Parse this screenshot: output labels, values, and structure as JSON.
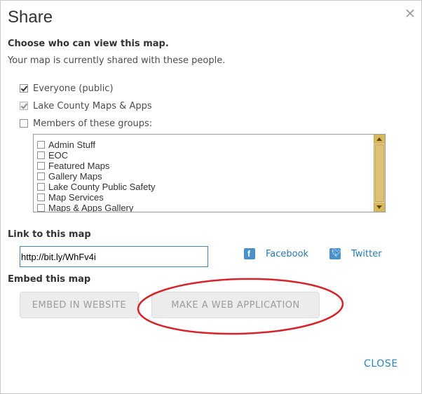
{
  "dialog": {
    "title": "Share",
    "close_icon": "close-icon"
  },
  "visibility": {
    "heading": "Choose who can view this map.",
    "description": "Your map is currently shared with these people.",
    "options": [
      {
        "label": "Everyone (public)",
        "checked": true,
        "disabled": false
      },
      {
        "label": "Lake County Maps & Apps",
        "checked": true,
        "disabled": true
      },
      {
        "label": "Members of these groups:",
        "checked": false,
        "disabled": false
      }
    ],
    "groups": [
      "Admin Stuff",
      "EOC",
      "Featured Maps",
      "Gallery Maps",
      "Lake County Public Safety",
      "Map Services",
      "Maps & Apps Gallery"
    ]
  },
  "link": {
    "heading": "Link to this map",
    "url": "http://bit.ly/WhFv4i",
    "facebook_label": "Facebook",
    "twitter_label": "Twitter"
  },
  "embed": {
    "heading": "Embed this map",
    "embed_button": "EMBED IN WEBSITE",
    "web_app_button": "MAKE A WEB APPLICATION"
  },
  "footer": {
    "close_label": "CLOSE"
  },
  "colors": {
    "accent": "#2a86b8",
    "annotation_circle": "#d8232a",
    "scrollbar": "#e8d39a"
  }
}
